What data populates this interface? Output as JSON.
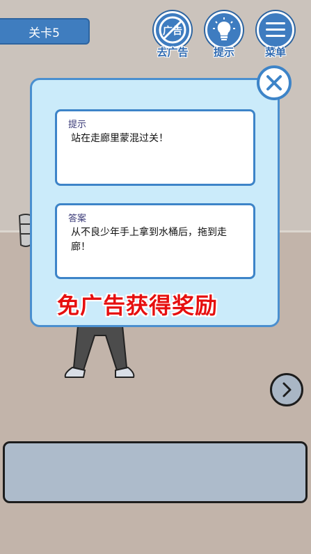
{
  "level": {
    "label": "关卡5"
  },
  "toolbar": {
    "ad_button": {
      "label": "去广告",
      "icon_text": "广告",
      "icon": "no-ads-icon"
    },
    "hint_button": {
      "label": "提示",
      "icon": "lightbulb-icon"
    },
    "menu_button": {
      "label": "菜单",
      "icon": "hamburger-icon"
    }
  },
  "dialog": {
    "close_icon": "close-icon",
    "hint": {
      "title": "提示",
      "text": "站在走廊里蒙混过关！"
    },
    "answer": {
      "title": "答案",
      "text": "从不良少年手上拿到水桶后，拖到走廊！"
    },
    "reward_text": "免广告获得奖励"
  },
  "navigation": {
    "next_icon": "chevron-right-icon"
  },
  "colors": {
    "accent_blue": "#3e7cc0",
    "dialog_bg": "#cbebfa",
    "reward_red": "#e60f0f"
  }
}
